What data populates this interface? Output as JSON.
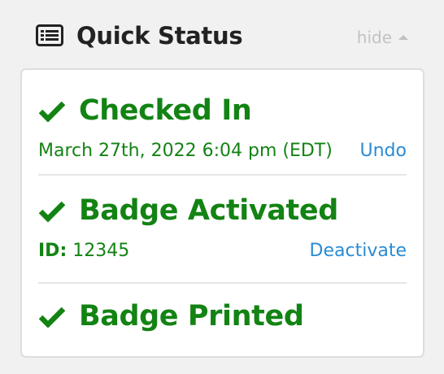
{
  "header": {
    "title": "Quick Status",
    "hide_label": "hide",
    "icon": "list-icon"
  },
  "statuses": [
    {
      "title": "Checked In",
      "icon": "check-icon",
      "detail": "March 27th, 2022 6:04 pm (EDT)",
      "action": "Undo"
    },
    {
      "title": "Badge Activated",
      "icon": "check-icon",
      "id_label": "ID:",
      "id_value": "12345",
      "action": "Deactivate"
    },
    {
      "title": "Badge Printed",
      "icon": "check-icon"
    }
  ],
  "colors": {
    "success": "#138313",
    "link": "#2a8bd4",
    "heading": "#222222",
    "muted": "#c2c2c2"
  }
}
